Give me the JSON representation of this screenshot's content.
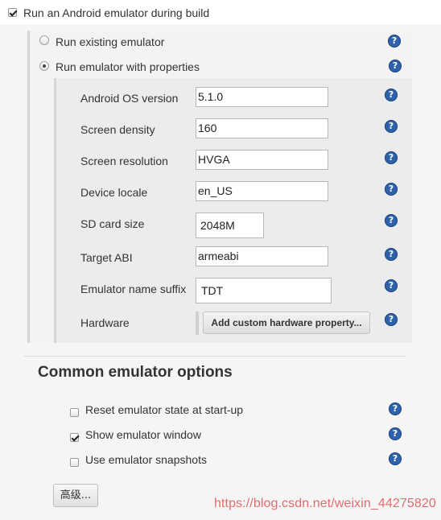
{
  "main_option": {
    "label": "Run an Android emulator during build",
    "checked": true
  },
  "emulator_mode": {
    "existing_label": "Run existing emulator",
    "properties_label": "Run emulator with properties",
    "selected": "properties"
  },
  "properties": {
    "android_os_version": {
      "label": "Android OS version",
      "value": "5.1.0"
    },
    "screen_density": {
      "label": "Screen density",
      "value": "160"
    },
    "screen_resolution": {
      "label": "Screen resolution",
      "value": "HVGA"
    },
    "device_locale": {
      "label": "Device locale",
      "value": "en_US"
    },
    "sd_card_size": {
      "label": "SD card size",
      "value": "2048M"
    },
    "target_abi": {
      "label": "Target ABI",
      "value": "armeabi"
    },
    "emulator_name_suffix": {
      "label": "Emulator name suffix",
      "value": "TDT"
    },
    "hardware": {
      "label": "Hardware",
      "button_label": "Add custom hardware property..."
    }
  },
  "common_options": {
    "title": "Common emulator options",
    "reset_state": {
      "label": "Reset emulator state at start-up",
      "checked": false
    },
    "show_window": {
      "label": "Show emulator window",
      "checked": true
    },
    "use_snapshots": {
      "label": "Use emulator snapshots",
      "checked": false
    },
    "advanced_button_label": "高级..."
  },
  "watermark": "https://blog.csdn.net/weixin_44275820",
  "icons": {
    "help": "help-icon"
  },
  "colors": {
    "help_icon": "#2f62a8",
    "watermark": "#e26d6d",
    "panel_background": "#f5f5f5"
  }
}
